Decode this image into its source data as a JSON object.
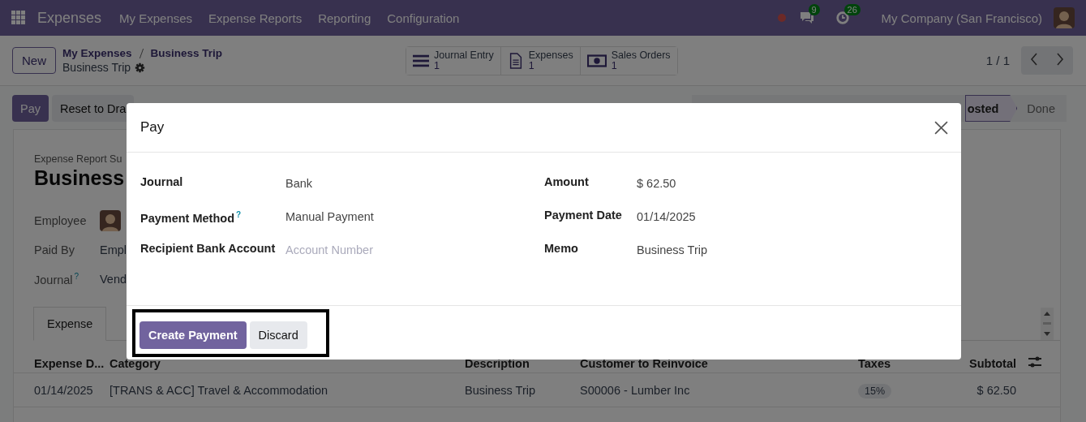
{
  "navbar": {
    "app": "Expenses",
    "menu": [
      "My Expenses",
      "Expense Reports",
      "Reporting",
      "Configuration"
    ],
    "messages_count": "9",
    "activities_count": "26",
    "company": "My Company (San Francisco)"
  },
  "control_panel": {
    "new_button": "New",
    "breadcrumb": [
      "My Expenses",
      "Business Trip"
    ],
    "record": "Business Trip",
    "smart_buttons": [
      {
        "label": "Journal Entry",
        "count": "1",
        "kind": "list"
      },
      {
        "label": "Expenses",
        "count": "1",
        "kind": "document"
      },
      {
        "label": "Sales Orders",
        "count": "1",
        "kind": "money"
      }
    ],
    "pager": "1 / 1"
  },
  "actions": [
    {
      "label": "Pay",
      "kind": "primary"
    },
    {
      "label": "Reset to Dra",
      "kind": "secondary"
    }
  ],
  "status_bar": [
    {
      "label": "osted",
      "selected": true
    },
    {
      "label": "Done",
      "selected": false
    }
  ],
  "form": {
    "subtitle": "Expense Report Su",
    "title": "Business",
    "fields": [
      {
        "label": "Employee",
        "kind": "avatar"
      },
      {
        "label": "Paid By",
        "kind": "text",
        "value": "Empl"
      },
      {
        "label": "Journal",
        "help": "?",
        "kind": "text",
        "value": "Vend"
      }
    ]
  },
  "tabs": [
    {
      "label": "Expense",
      "selected": true
    }
  ],
  "table": {
    "columns": [
      "Expense D...",
      "Category",
      "Description",
      "Customer to Reinvoice",
      "Taxes",
      "Subtotal"
    ],
    "rows": [
      {
        "cells": [
          "01/14/2025",
          "[TRANS & ACC] Travel & Accommodation",
          "Business Trip",
          "S00006 - Lumber Inc",
          "15%",
          "$ 62.50"
        ]
      }
    ]
  },
  "dialog": {
    "title": "Pay",
    "left_fields": [
      {
        "label": "Journal",
        "value": "Bank"
      },
      {
        "label": "Payment Method",
        "help": "?",
        "value": "Manual Payment"
      },
      {
        "label": "Recipient Bank Account",
        "placeholder": "Account Number"
      }
    ],
    "right_fields": [
      {
        "label": "Amount",
        "value": "$ 62.50"
      },
      {
        "label": "Payment Date",
        "value": "01/14/2025"
      },
      {
        "label": "Memo",
        "value": "Business Trip"
      }
    ],
    "buttons": [
      {
        "label": "Create Payment",
        "kind": "primary"
      },
      {
        "label": "Discard",
        "kind": "secondary"
      }
    ]
  }
}
